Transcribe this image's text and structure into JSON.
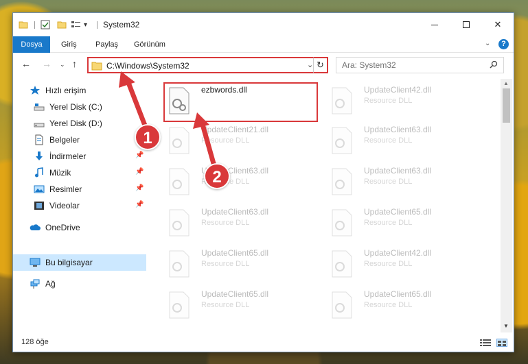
{
  "window": {
    "title": "System32",
    "minimize_icon": "minimize-icon",
    "maximize_icon": "maximize-icon",
    "close_glyph": "✕"
  },
  "ribbon": {
    "tabs": [
      {
        "label": "Dosya"
      },
      {
        "label": "Giriş"
      },
      {
        "label": "Paylaş"
      },
      {
        "label": "Görünüm"
      }
    ],
    "help_label": "?"
  },
  "address_bar": {
    "path": "C:\\Windows\\System32",
    "refresh_glyph": "↻"
  },
  "search": {
    "placeholder": "Ara: System32"
  },
  "nav_pane": {
    "items": [
      {
        "label": "Hızlı erişim"
      },
      {
        "label": "Yerel Disk (C:)"
      },
      {
        "label": "Yerel Disk (D:)"
      },
      {
        "label": "Belgeler"
      },
      {
        "label": "İndirmeler"
      },
      {
        "label": "Müzik"
      },
      {
        "label": "Resimler"
      },
      {
        "label": "Videolar"
      },
      {
        "label": "OneDrive"
      },
      {
        "label": "Bu bilgisayar"
      },
      {
        "label": "Ağ"
      }
    ]
  },
  "files": {
    "column1": [
      {
        "name": "ezbwords.dll",
        "type": ""
      },
      {
        "name": "UpdateClient21.dll",
        "type": "Resource DLL"
      },
      {
        "name": "UpdateClient63.dll",
        "type": "Resource DLL"
      },
      {
        "name": "UpdateClient63.dll",
        "type": "Resource DLL"
      },
      {
        "name": "UpdateClient65.dll",
        "type": "Resource DLL"
      },
      {
        "name": "UpdateClient65.dll",
        "type": "Resource DLL"
      }
    ],
    "column2": [
      {
        "name": "UpdateClient42.dll",
        "type": "Resource DLL"
      },
      {
        "name": "UpdateClient63.dll",
        "type": "Resource DLL"
      },
      {
        "name": "UpdateClient63.dll",
        "type": "Resource DLL"
      },
      {
        "name": "UpdateClient65.dll",
        "type": "Resource DLL"
      },
      {
        "name": "UpdateClient42.dll",
        "type": "Resource DLL"
      },
      {
        "name": "UpdateClient65.dll",
        "type": "Resource DLL"
      }
    ]
  },
  "status_bar": {
    "item_count": "128 öğe"
  },
  "annotations": {
    "step1": "1",
    "step2": "2"
  },
  "colors": {
    "accent": "#1979ca",
    "annotation_red": "#d9383a",
    "selection": "#cce8ff"
  }
}
